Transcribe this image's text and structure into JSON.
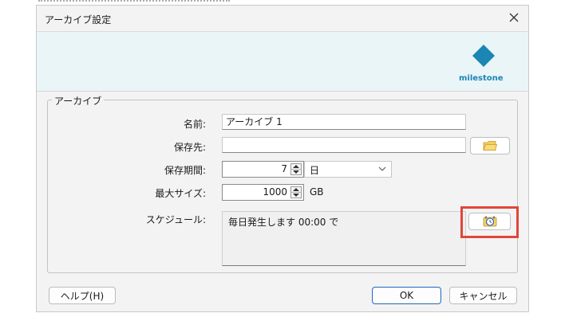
{
  "window": {
    "title": "アーカイブ設定"
  },
  "brand": {
    "name": "milestone",
    "color": "#1a86b4",
    "icon": "milestone-diamond-logo"
  },
  "group": {
    "title": "アーカイブ"
  },
  "form": {
    "name": {
      "label": "名前:",
      "value": "アーカイブ 1"
    },
    "destination": {
      "label": "保存先:",
      "value": "",
      "browse_icon": "folder-icon"
    },
    "retention": {
      "label": "保存期間:",
      "value": "7",
      "unit": "日"
    },
    "max_size": {
      "label": "最大サイズ:",
      "value": "1000",
      "unit": "GB"
    },
    "schedule": {
      "label": "スケジュール:",
      "value": "毎日発生します 00:00 で",
      "edit_icon": "schedule-clock-icon",
      "highlight_color": "#e0463a"
    }
  },
  "buttons": {
    "help": "ヘルプ(H)",
    "ok": "OK",
    "cancel": "キャンセル"
  }
}
